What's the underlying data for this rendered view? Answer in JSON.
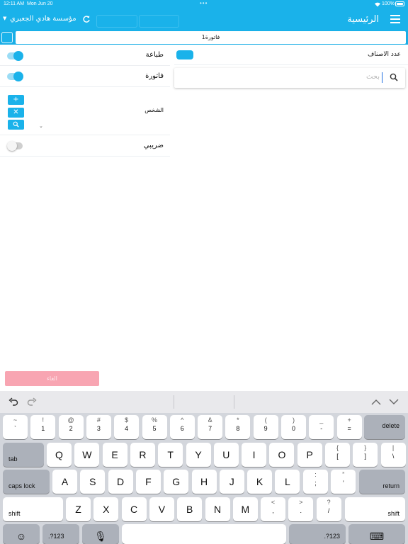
{
  "status_bar": {
    "time": "12:11 AM",
    "date": "Mon Jun 20",
    "battery": "100%"
  },
  "header": {
    "title": "الرئيسية",
    "company": "مؤسسة هادي الجعبري"
  },
  "subheader": {
    "invoice_field": "فاتورة1"
  },
  "items_panel": {
    "count_label": "عدد الاصناف",
    "search_placeholder": "بحث"
  },
  "options": {
    "print_label": "طباعة",
    "print_on": true,
    "invoice_label": "فاتورة",
    "invoice_on": true,
    "person_label": "الشخص",
    "tax_label": "ضريبي",
    "tax_on": false
  },
  "save_label": "الغاء",
  "keyboard": {
    "number_row": [
      {
        "top": "~",
        "bot": "`"
      },
      {
        "top": "!",
        "bot": "1"
      },
      {
        "top": "@",
        "bot": "2"
      },
      {
        "top": "#",
        "bot": "3"
      },
      {
        "top": "$",
        "bot": "4"
      },
      {
        "top": "%",
        "bot": "5"
      },
      {
        "top": "^",
        "bot": "6"
      },
      {
        "top": "&",
        "bot": "7"
      },
      {
        "top": "*",
        "bot": "8"
      },
      {
        "top": "(",
        "bot": "9"
      },
      {
        "top": ")",
        "bot": "0"
      },
      {
        "top": "_",
        "bot": "-"
      },
      {
        "top": "+",
        "bot": "="
      }
    ],
    "delete": "delete",
    "tab": "tab",
    "row_q": [
      "Q",
      "W",
      "E",
      "R",
      "T",
      "Y",
      "U",
      "I",
      "O",
      "P"
    ],
    "row_q_extra": [
      {
        "top": "{",
        "bot": "["
      },
      {
        "top": "}",
        "bot": "]"
      },
      {
        "top": "|",
        "bot": "\\"
      }
    ],
    "caps": "caps lock",
    "row_a": [
      "A",
      "S",
      "D",
      "F",
      "G",
      "H",
      "J",
      "K",
      "L"
    ],
    "row_a_extra": [
      {
        "top": ":",
        "bot": ";"
      },
      {
        "top": "”",
        "bot": "’"
      }
    ],
    "return": "return",
    "shift": "shift",
    "row_z": [
      "Z",
      "X",
      "C",
      "V",
      "B",
      "N",
      "M"
    ],
    "row_z_extra": [
      {
        "top": "<",
        "bot": ","
      },
      {
        "top": ">",
        "bot": "."
      },
      {
        "top": "?",
        "bot": "/"
      }
    ],
    "numbers_key": ".?123"
  }
}
